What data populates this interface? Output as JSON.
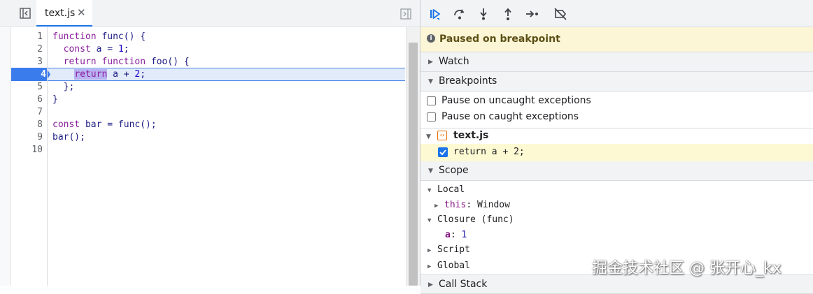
{
  "editor": {
    "tab": {
      "label": "text.js",
      "close": "✕"
    },
    "lines": [
      {
        "num": "1",
        "text": "function func() {"
      },
      {
        "num": "2",
        "text": "  const a = 1;"
      },
      {
        "num": "3",
        "text": "  return function foo() {"
      },
      {
        "num": "4",
        "text": "    return a + 2;"
      },
      {
        "num": "5",
        "text": "  };"
      },
      {
        "num": "6",
        "text": "}"
      },
      {
        "num": "7",
        "text": ""
      },
      {
        "num": "8",
        "text": "const bar = func();"
      },
      {
        "num": "9",
        "text": "bar();"
      },
      {
        "num": "10",
        "text": ""
      }
    ],
    "current_line": "4"
  },
  "debugger": {
    "toolbar": {
      "icons": [
        "resume-icon",
        "step-over-icon",
        "step-into-icon",
        "step-out-icon",
        "step-icon",
        "deactivate-breakpoints-icon"
      ]
    },
    "paused_message": "Paused on breakpoint",
    "sections": {
      "watch": "Watch",
      "breakpoints": "Breakpoints",
      "scope": "Scope",
      "call_stack": "Call Stack"
    },
    "exceptions": {
      "uncaught": "Pause on uncaught exceptions",
      "caught": "Pause on caught exceptions"
    },
    "breakpoint_file": "text.js",
    "breakpoint_code": "return a + 2;",
    "scope": {
      "local": "Local",
      "this_key": "this",
      "this_value": "Window",
      "closure": "Closure (func)",
      "closure_var_key": "a",
      "closure_var_value": "1",
      "script": "Script",
      "global": "Global"
    }
  },
  "watermark": "掘金技术社区 @ 张开心_kx",
  "colors": {
    "accent": "#1a73e8",
    "paused_bg": "#fdf6d6",
    "exec_line_bg": "#e2ebfa",
    "keyword": "#8a1e9c"
  }
}
